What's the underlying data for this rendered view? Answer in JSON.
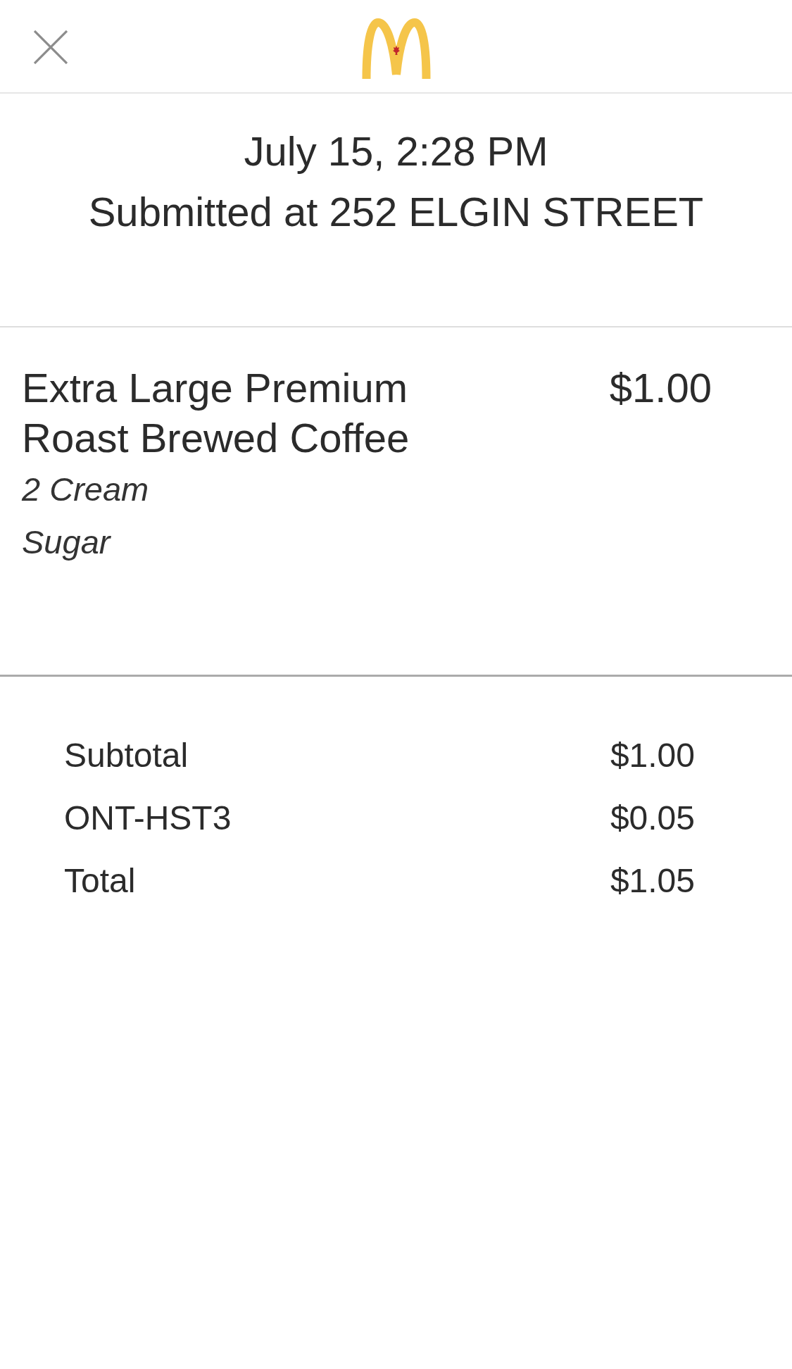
{
  "order": {
    "time": "July 15, 2:28 PM",
    "location": "Submitted at 252 ELGIN STREET"
  },
  "items": [
    {
      "name": "Extra Large Premium Roast Brewed Coffee",
      "price": "$1.00",
      "modifiers": [
        "2 Cream",
        "Sugar"
      ]
    }
  ],
  "totals": [
    {
      "label": "Subtotal",
      "amount": "$1.00"
    },
    {
      "label": "ONT-HST3",
      "amount": "$0.05"
    },
    {
      "label": "Total",
      "amount": "$1.05"
    }
  ]
}
